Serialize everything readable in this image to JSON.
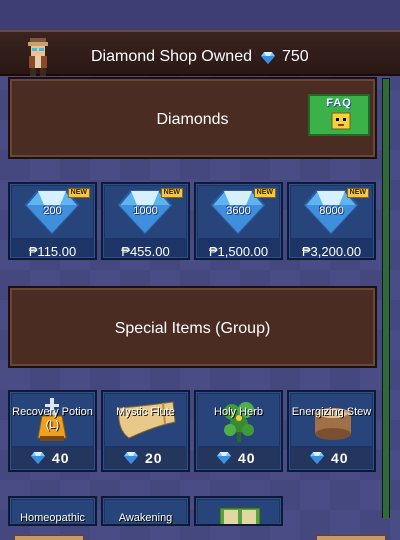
{
  "header": {
    "title": "Diamond Shop Owned",
    "gem_icon": "diamond-icon",
    "owned_count": "750"
  },
  "diamonds_section": {
    "title": "Diamonds",
    "faq_label": "FAQ"
  },
  "diamond_packs": [
    {
      "amount": "200",
      "price": "₱115.00",
      "badge": "NEW"
    },
    {
      "amount": "1000",
      "price": "₱455.00",
      "badge": "NEW"
    },
    {
      "amount": "3600",
      "price": "₱1,500.00",
      "badge": "NEW"
    },
    {
      "amount": "8000",
      "price": "₱3,200.00",
      "badge": "NEW"
    }
  ],
  "special_section": {
    "title": "Special Items (Group)"
  },
  "special_items": [
    {
      "name": "Recovery Potion (L)",
      "cost": "40",
      "icon": "potion-icon"
    },
    {
      "name": "Mystic Flute",
      "cost": "20",
      "icon": "horn-icon"
    },
    {
      "name": "Holy Herb",
      "cost": "40",
      "icon": "herb-icon"
    },
    {
      "name": "Energizing Stew",
      "cost": "40",
      "icon": "stew-icon"
    }
  ],
  "special_items_row2": [
    {
      "name": "Homeopathic",
      "icon": "item-icon"
    },
    {
      "name": "Awakening",
      "icon": "item-icon"
    },
    {
      "name": "",
      "icon": "book-icon"
    }
  ],
  "colors": {
    "background": "#4a4c86",
    "header": "#3b2420",
    "section": "#4a2c22",
    "card": "#1c3566",
    "faq": "#3bb14a"
  }
}
